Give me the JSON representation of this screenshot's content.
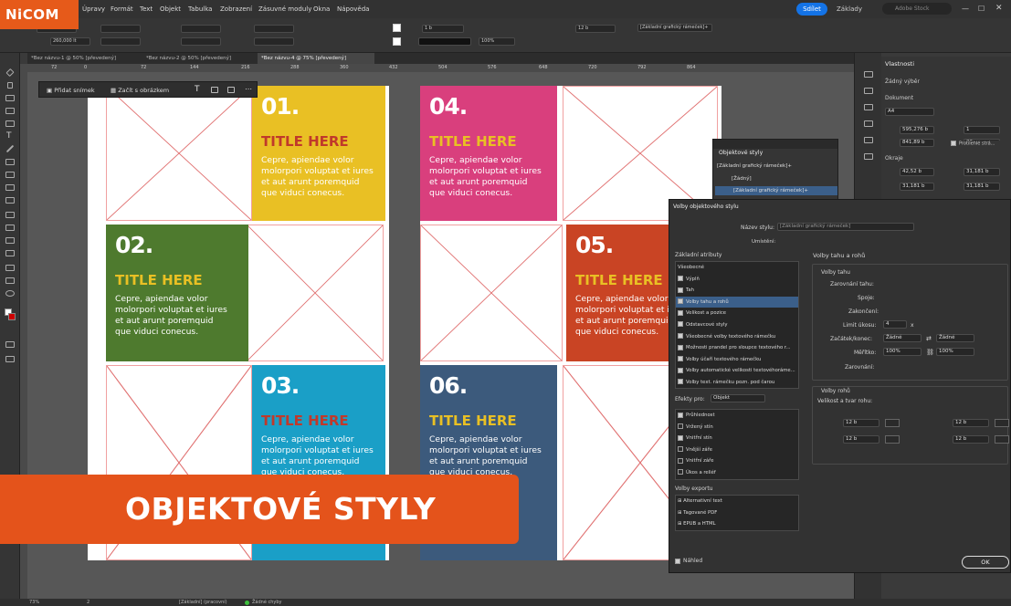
{
  "brand": {
    "logo": "NiCOM"
  },
  "menu": [
    "Úpravy",
    "Formát",
    "Text",
    "Objekt",
    "Tabulka",
    "Zobrazení",
    "Zásuvné moduly",
    "Okna",
    "Nápověda"
  ],
  "header": {
    "share_label": "Sdílet",
    "workspace": "Základy",
    "stock_placeholder": "Adobe Stock"
  },
  "control": {
    "y_value": "260,000 lt",
    "stroke_weight": "1 b",
    "zoom": "100%",
    "corner": "12 b",
    "style_field": "[Základní grafický rámeček]+"
  },
  "tabs": [
    {
      "label": "*Bez názvu-1 @ 50% [převedený]",
      "active": false
    },
    {
      "label": "*Bez názvu-2 @ 50% [převedený]",
      "active": false
    },
    {
      "label": "*Bez názvu-4 @ 75% [převedený]",
      "active": true
    }
  ],
  "ruler_ticks": [
    "72",
    "0",
    "72",
    "144",
    "216",
    "288",
    "360",
    "432",
    "504",
    "576",
    "648",
    "720",
    "792",
    "864"
  ],
  "floatbar": {
    "add_slide": "Přidat snímek",
    "start_with_image": "Začít s obrázkem"
  },
  "cards": [
    {
      "num": "01.",
      "title": "TITLE HERE",
      "body": "Cepre, apiendae volor molorpori voluptat et iures et aut arunt poremquid que viduci conecus.",
      "bg": "#e9c024",
      "title_color": "#c0392b"
    },
    {
      "num": "02.",
      "title": "TITLE HERE",
      "body": "Cepre, apiendae volor molorpori voluptat et iures et aut arunt poremquid que viduci conecus.",
      "bg": "#4e7a2e",
      "title_color": "#e9c024"
    },
    {
      "num": "03.",
      "title": "TITLE HERE",
      "body": "Cepre, apiendae volor molorpori voluptat et iures et aut arunt poremquid que viduci conecus.",
      "bg": "#1a9fc7",
      "title_color": "#c0392b"
    },
    {
      "num": "04.",
      "title": "TITLE HERE",
      "body": "Cepre, apiendae volor molorpori voluptat et iures et aut arunt poremquid que viduci conecus.",
      "bg": "#d93f7d",
      "title_color": "#e9c024"
    },
    {
      "num": "05.",
      "title": "TITLE HERE",
      "body": "Cepre, apiendae volor molorpori voluptat et iures et aut arunt poremquid que viduci conecus.",
      "bg": "#c94424",
      "title_color": "#e9c024"
    },
    {
      "num": "06.",
      "title": "TITLE HERE",
      "body": "Cepre, apiendae volor molorpori voluptat et iures et aut arunt poremquid que viduci conecus.",
      "bg": "#3c5a7c",
      "title_color": "#e9c024"
    }
  ],
  "object_styles_panel": {
    "title": "Objektové styly",
    "current": "[Základní grafický rámeček]+",
    "items": [
      "[Žádný]",
      "[Základní grafický rámeček]+"
    ]
  },
  "properties": {
    "title": "Vlastnosti",
    "no_selection": "Žádný výběr",
    "document_label": "Dokument",
    "page_size": "A4",
    "width": "595,276 b",
    "height": "841,89 b",
    "pages": "1",
    "facing": "22",
    "facing_label": "Protilehlé strá...",
    "margins_label": "Okraje",
    "margin_top": "42,52 b",
    "margin_bottom": "31,181 b",
    "margin_left": "31,181 b",
    "margin_right": "31,181 b"
  },
  "dialog": {
    "title": "Volby objektového stylu",
    "name_label": "Název stylu:",
    "name_value": "[Základní grafický rámeček]",
    "location_label": "Umístění:",
    "basic_attrs_label": "Základní atributy",
    "basic_attrs": [
      {
        "label": "Všeobecné",
        "checked": null
      },
      {
        "label": "Výplň",
        "checked": true
      },
      {
        "label": "Tah",
        "checked": true
      },
      {
        "label": "Volby tahu a rohů",
        "checked": true,
        "selected": true
      },
      {
        "label": "Velikost a pozice",
        "checked": true
      },
      {
        "label": "Odstavcové styly",
        "checked": true
      },
      {
        "label": "Všeobecné volby textového rámečku",
        "checked": true
      },
      {
        "label": "Možnosti prandel pro sloupce textového r...",
        "checked": true
      },
      {
        "label": "Volby účaří textového rámečku",
        "checked": true
      },
      {
        "label": "Volby automatické velikosti textovéhoráme...",
        "checked": true
      },
      {
        "label": "Volby text. rámečku pozn. pod čarou",
        "checked": true
      }
    ],
    "effects_label": "Efekty pro:",
    "effects_target": "Objekt",
    "effects": [
      {
        "label": "Průhlednost",
        "checked": true
      },
      {
        "label": "Vržený stín",
        "checked": false
      },
      {
        "label": "Vnitřní stín",
        "checked": true
      },
      {
        "label": "Vnější záře",
        "checked": false
      },
      {
        "label": "Vnitřní záře",
        "checked": false
      },
      {
        "label": "Úkos a reliéf",
        "checked": false
      }
    ],
    "export_label": "Volby exportu",
    "exports": [
      "Alternativní text",
      "Tagované PDF",
      "EPUB a HTML"
    ],
    "preview_label": "Náhled",
    "ok_label": "OK",
    "section_title": "Volby tahu a rohů",
    "stroke_section": "Volby tahu",
    "align_label": "Zarovnání tahu:",
    "join_label": "Spoje:",
    "cap_label": "Zakončení:",
    "miter_label": "Limit úkosu:",
    "miter_value": "4",
    "miter_unit": "x",
    "startend_label": "Začátek/konec:",
    "start_value": "Žádné",
    "end_value": "Žádné",
    "scale_label": "Měřítko:",
    "scale_start": "100%",
    "scale_end": "100%",
    "arrow_align_label": "Zarovnání:",
    "corner_section": "Volby rohů",
    "corner_size_label": "Velikost a tvar rohu:",
    "corner_values": [
      "12 b",
      "12 b",
      "12 b",
      "12 b"
    ]
  },
  "banner": {
    "text": "OBJEKTOVÉ STYLY"
  },
  "status": {
    "zoom": "73%",
    "page": "2",
    "mode": "[Základní] (pracovní)",
    "errors": "Žádné chyby"
  }
}
